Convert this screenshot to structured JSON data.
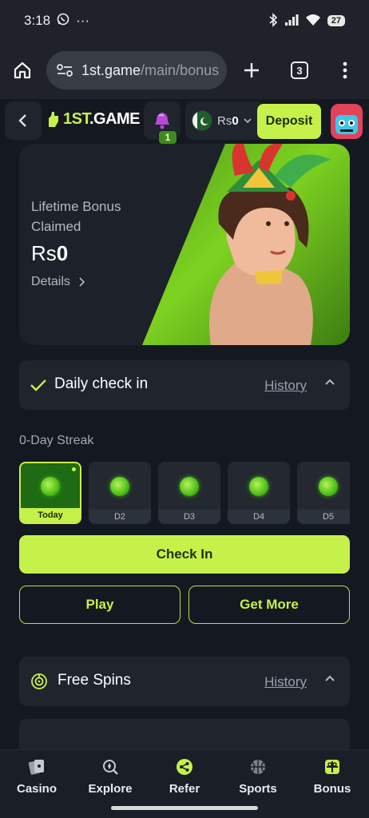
{
  "status_bar": {
    "time": "3:18",
    "more": "···",
    "battery": "27"
  },
  "browser": {
    "url_host": "1st.game",
    "url_path": "/main/bonus",
    "tab_count": "3"
  },
  "header": {
    "logo_prefix": "1ST",
    "logo_suffix": ".GAME",
    "notification_count": "1",
    "currency": "Rs",
    "balance": "0",
    "deposit_label": "Deposit"
  },
  "hero": {
    "label": "Lifetime Bonus Claimed",
    "currency": "Rs",
    "amount": "0",
    "details_label": "Details"
  },
  "daily_checkin": {
    "title": "Daily check in",
    "history_label": "History",
    "streak_label": "0-Day Streak",
    "days": [
      "Today",
      "D2",
      "D3",
      "D4",
      "D5"
    ],
    "checkin_label": "Check In",
    "play_label": "Play",
    "get_more_label": "Get More"
  },
  "free_spins": {
    "title": "Free Spins",
    "history_label": "History"
  },
  "bottom_nav": {
    "items": [
      {
        "label": "Casino",
        "icon": "casino-cards-icon"
      },
      {
        "label": "Explore",
        "icon": "explore-search-icon"
      },
      {
        "label": "Refer",
        "icon": "share-icon"
      },
      {
        "label": "Sports",
        "icon": "basketball-icon"
      },
      {
        "label": "Bonus",
        "icon": "gift-icon"
      }
    ]
  },
  "colors": {
    "accent": "#c6f14a",
    "background": "#141820",
    "card": "#1f242d"
  }
}
